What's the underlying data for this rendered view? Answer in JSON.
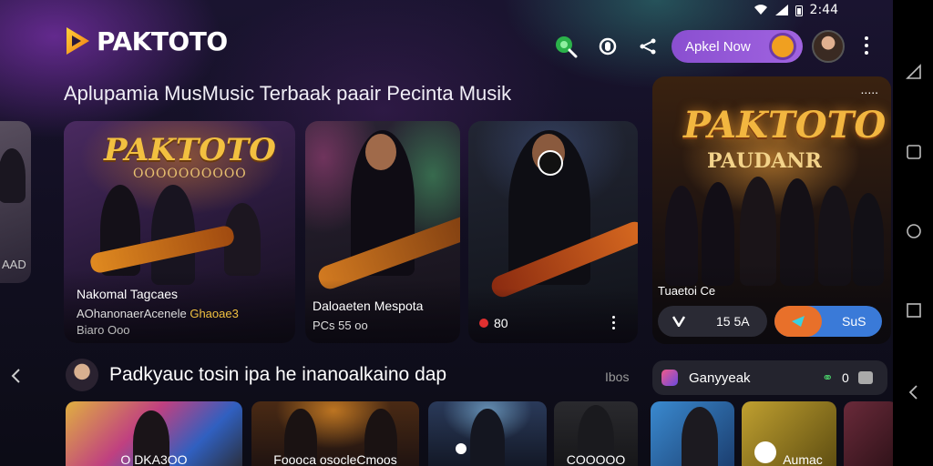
{
  "status_bar": {
    "time": "2:44"
  },
  "app": {
    "brand": "PAKTOTO",
    "apply_button": "Apkel Now"
  },
  "header": {
    "heading": "Aplupamia MusMusic Terbaak paair Pecinta Musik"
  },
  "featured_cards": [
    {
      "overlay_title": "PAKTOTO",
      "overlay_sub": "OOOOOOOOOO",
      "title": "Nakomal Tagcaes",
      "line2": "AOhanonaerAcenele",
      "line2_tag": "Ghaoae3",
      "line3": "Biaro Ooo"
    },
    {
      "title": "Daloaeten Mespota",
      "line2": "PCs 55 oo"
    },
    {
      "badge": "80"
    }
  ],
  "side_panel": {
    "brand": "PAKTOTO",
    "subtitle": "PAUDANR",
    "caption": "Tuaetoi Ce",
    "stat_label": "15 5A",
    "action_label": "SuS",
    "more": "....."
  },
  "left_edge": {
    "caption": "AAD"
  },
  "row2": {
    "title": "Padkyauc tosin ipa he inanoalkaino dap",
    "see_all": "Ibos",
    "chip_label": "Ganyyeak",
    "chip_count": "0"
  },
  "thumbnails": [
    {
      "caption": "O DKA3OO"
    },
    {
      "caption": "Foooca osocleCmoos"
    },
    {
      "caption": ""
    },
    {
      "caption": "COOOOO"
    },
    {
      "caption": ""
    },
    {
      "caption": "Aumac"
    }
  ],
  "icons": {
    "search": "search-icon",
    "sync": "sync-icon",
    "share": "share-icon",
    "more": "more-vertical-icon"
  }
}
